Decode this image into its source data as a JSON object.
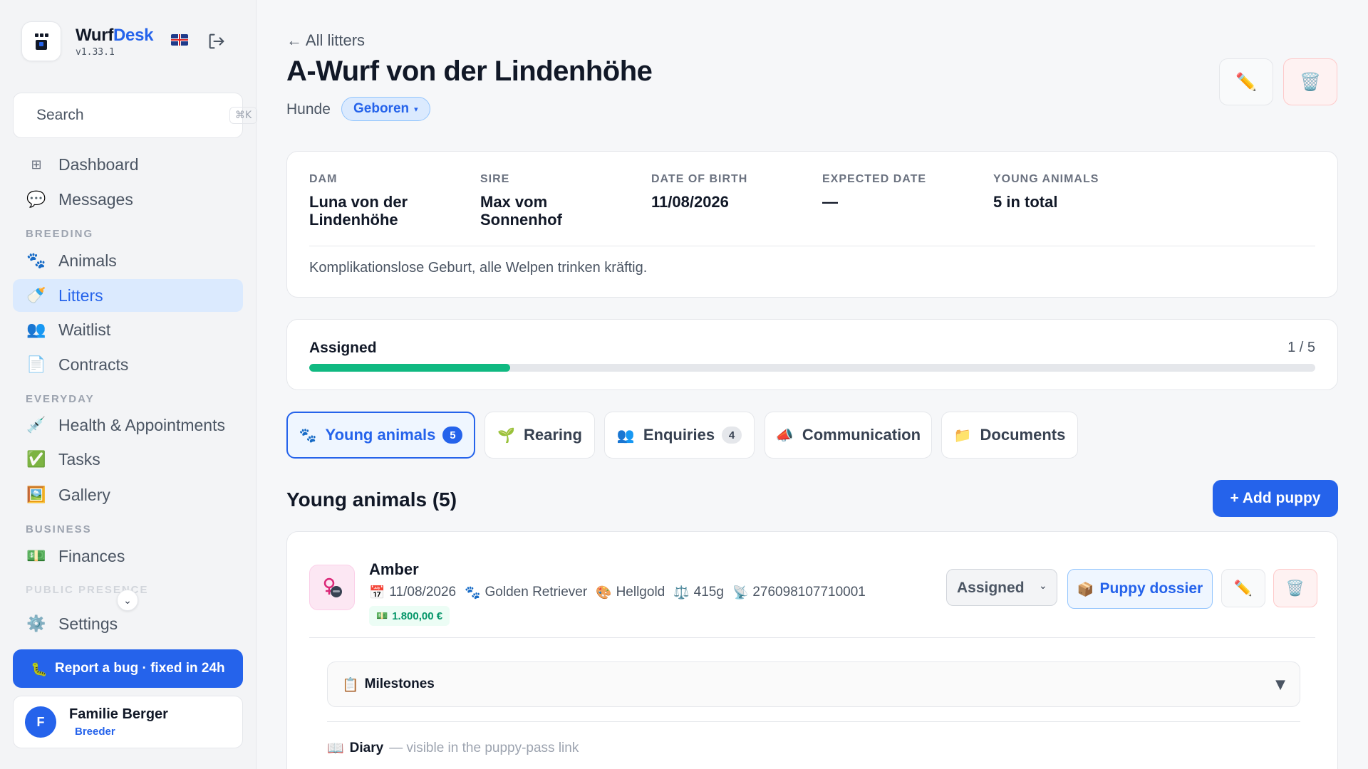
{
  "brand": {
    "name_part1": "Wurf",
    "name_part2": "Desk",
    "version": "v1.33.1",
    "language_flag": "uk-flag-icon"
  },
  "search": {
    "placeholder": "Search",
    "shortcut": "⌘K"
  },
  "nav": {
    "dashboard": "Dashboard",
    "messages": "Messages",
    "section_breeding": "BREEDING",
    "animals": "Animals",
    "litters": "Litters",
    "waitlist": "Waitlist",
    "contracts": "Contracts",
    "section_everyday": "EVERYDAY",
    "health": "Health & Appointments",
    "tasks": "Tasks",
    "gallery": "Gallery",
    "section_business": "BUSINESS",
    "finances": "Finances",
    "section_public": "PUBLIC PRESENCE",
    "settings": "Settings"
  },
  "report_bug": "Report a bug · fixed in 24h",
  "user": {
    "initial": "F",
    "name": "Familie Berger",
    "role": "Breeder"
  },
  "header": {
    "back": "← All litters",
    "title": "A-Wurf von der Lindenhöhe",
    "species": "Hunde",
    "status": "Geboren"
  },
  "info": {
    "dam_label": "DAM",
    "dam_value": "Luna von der Lindenhöhe",
    "sire_label": "SIRE",
    "sire_value": "Max vom Sonnenhof",
    "dob_label": "DATE OF BIRTH",
    "dob_value": "11/08/2026",
    "expected_label": "EXPECTED DATE",
    "expected_value": "—",
    "young_label": "YOUNG ANIMALS",
    "young_value": "5 in total",
    "note": "Komplikationslose Geburt, alle Welpen trinken kräftig."
  },
  "progress": {
    "label": "Assigned",
    "count": "1 / 5",
    "assigned": 1,
    "total": 5
  },
  "tabs": {
    "young": "Young animals",
    "young_count": "5",
    "rearing": "Rearing",
    "enquiries": "Enquiries",
    "enquiries_count": "4",
    "communication": "Communication",
    "documents": "Documents"
  },
  "section": {
    "title": "Young animals (5)",
    "add_button": "+ Add puppy"
  },
  "puppy": {
    "name": "Amber",
    "dob": "11/08/2026",
    "breed": "Golden Retriever",
    "color": "Hellgold",
    "weight": "415g",
    "chip": "276098107710001",
    "price": "1.800,00 €",
    "status": "Assigned",
    "status_options": [
      "Assigned"
    ],
    "dossier": "Puppy dossier",
    "milestones": "Milestones",
    "diary_label": "Diary",
    "diary_hint": "— visible in the puppy-pass link"
  }
}
